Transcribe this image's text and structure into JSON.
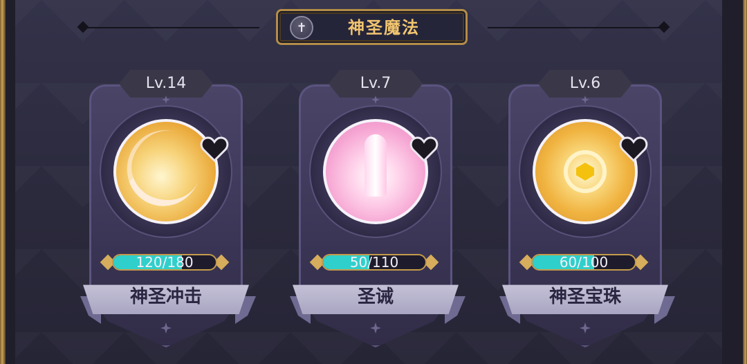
{
  "header": {
    "title": "神圣魔法",
    "icon": "cross-emblem-icon"
  },
  "spells": [
    {
      "level": "Lv.14",
      "progress_text": "120/180",
      "progress_current": 120,
      "progress_max": 180,
      "name": "神圣冲击",
      "icon": "holy-strike-icon",
      "orb_color": "#f2c25a"
    },
    {
      "level": "Lv.7",
      "progress_text": "50/110",
      "progress_current": 50,
      "progress_max": 110,
      "name": "圣诫",
      "icon": "holy-pillar-icon",
      "orb_color": "#f6a6d3"
    },
    {
      "level": "Lv.6",
      "progress_text": "60/100",
      "progress_current": 60,
      "progress_max": 100,
      "name": "神圣宝珠",
      "icon": "holy-orb-icon",
      "orb_color": "#f0b340"
    }
  ],
  "colors": {
    "bar_fill": "#2fd0cb",
    "title_text": "#f2c56f",
    "gold_border": "#b48d47"
  }
}
